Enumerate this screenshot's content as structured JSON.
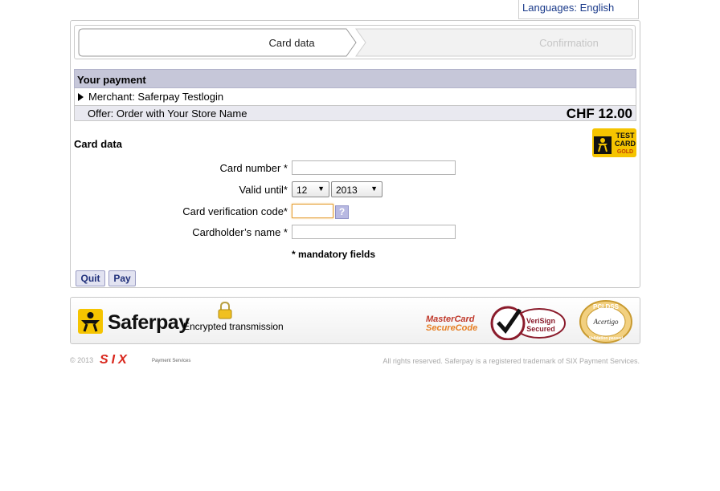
{
  "header": {
    "languages_label": "Languages: English"
  },
  "steps": [
    {
      "label": "Card data",
      "active": true
    },
    {
      "label": "Confirmation",
      "active": false
    }
  ],
  "payment": {
    "title": "Your payment",
    "merchant": "Merchant: Saferpay Testlogin",
    "offer": "Offer: Order with Your Store Name",
    "amount": "CHF 12.00"
  },
  "card_section": {
    "title": "Card data",
    "test_card_badge": [
      "TEST",
      "CARD",
      "GOLD"
    ]
  },
  "form": {
    "card_number_label": "Card number *",
    "card_number_value": "",
    "valid_until_label": "Valid until*",
    "valid_month": "12",
    "valid_year": "2013",
    "cvc_label": "Card verification code*",
    "cvc_value": "",
    "cvc_help_icon": "question-icon",
    "help_glyph": "?",
    "holder_label": "Cardholder’s name *",
    "holder_value": "",
    "mandatory_note": "* mandatory fields"
  },
  "buttons": {
    "quit": "Quit",
    "pay": "Pay"
  },
  "footer": {
    "brand": "Saferpay",
    "encrypted": "Encrypted transmission",
    "mastercard_line1": "MasterCard",
    "mastercard_line2": "SecureCode",
    "verisign_line1": "VeriSign",
    "verisign_line2": "Secured",
    "pci_line1": "PCI DSS",
    "pci_line2": "Acertigo",
    "pci_line3": "Validation passed",
    "copyright": "© 2013",
    "six_logo": "SIX",
    "payment_services": "Payment Services",
    "rights": "All rights reserved. Saferpay is a registered trademark of SIX Payment Services."
  },
  "colors": {
    "header_bg": "#c6c7d9",
    "link": "#1a3a8a",
    "button_text": "#1f2f7a",
    "saferpay_yellow": "#f5c400"
  }
}
